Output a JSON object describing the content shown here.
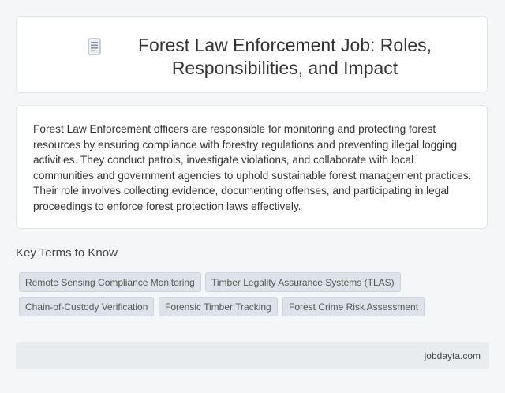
{
  "header": {
    "icon": "document-icon",
    "title_line1": "Forest Law Enforcement Job: Roles,",
    "title_line2": "Responsibilities, and Impact"
  },
  "description": "Forest Law Enforcement officers are responsible for monitoring and protecting forest resources by ensuring compliance with forestry regulations and preventing illegal logging activities. They conduct patrols, investigate violations, and collaborate with local communities and government agencies to uphold sustainable forest management practices. Their role involves collecting evidence, documenting offenses, and participating in legal proceedings to enforce forest protection laws effectively.",
  "key_terms": {
    "heading": "Key Terms to Know",
    "tags": [
      "Remote Sensing Compliance Monitoring",
      "Timber Legality Assurance Systems (TLAS)",
      "Chain-of-Custody Verification",
      "Forensic Timber Tracking",
      "Forest Crime Risk Assessment"
    ]
  },
  "footer": {
    "site": "jobdayta.com"
  },
  "colors": {
    "background": "#f4f6f8",
    "card": "#ffffff",
    "tag_bg": "#dde3e8",
    "footer_bg": "#e8ecee"
  }
}
